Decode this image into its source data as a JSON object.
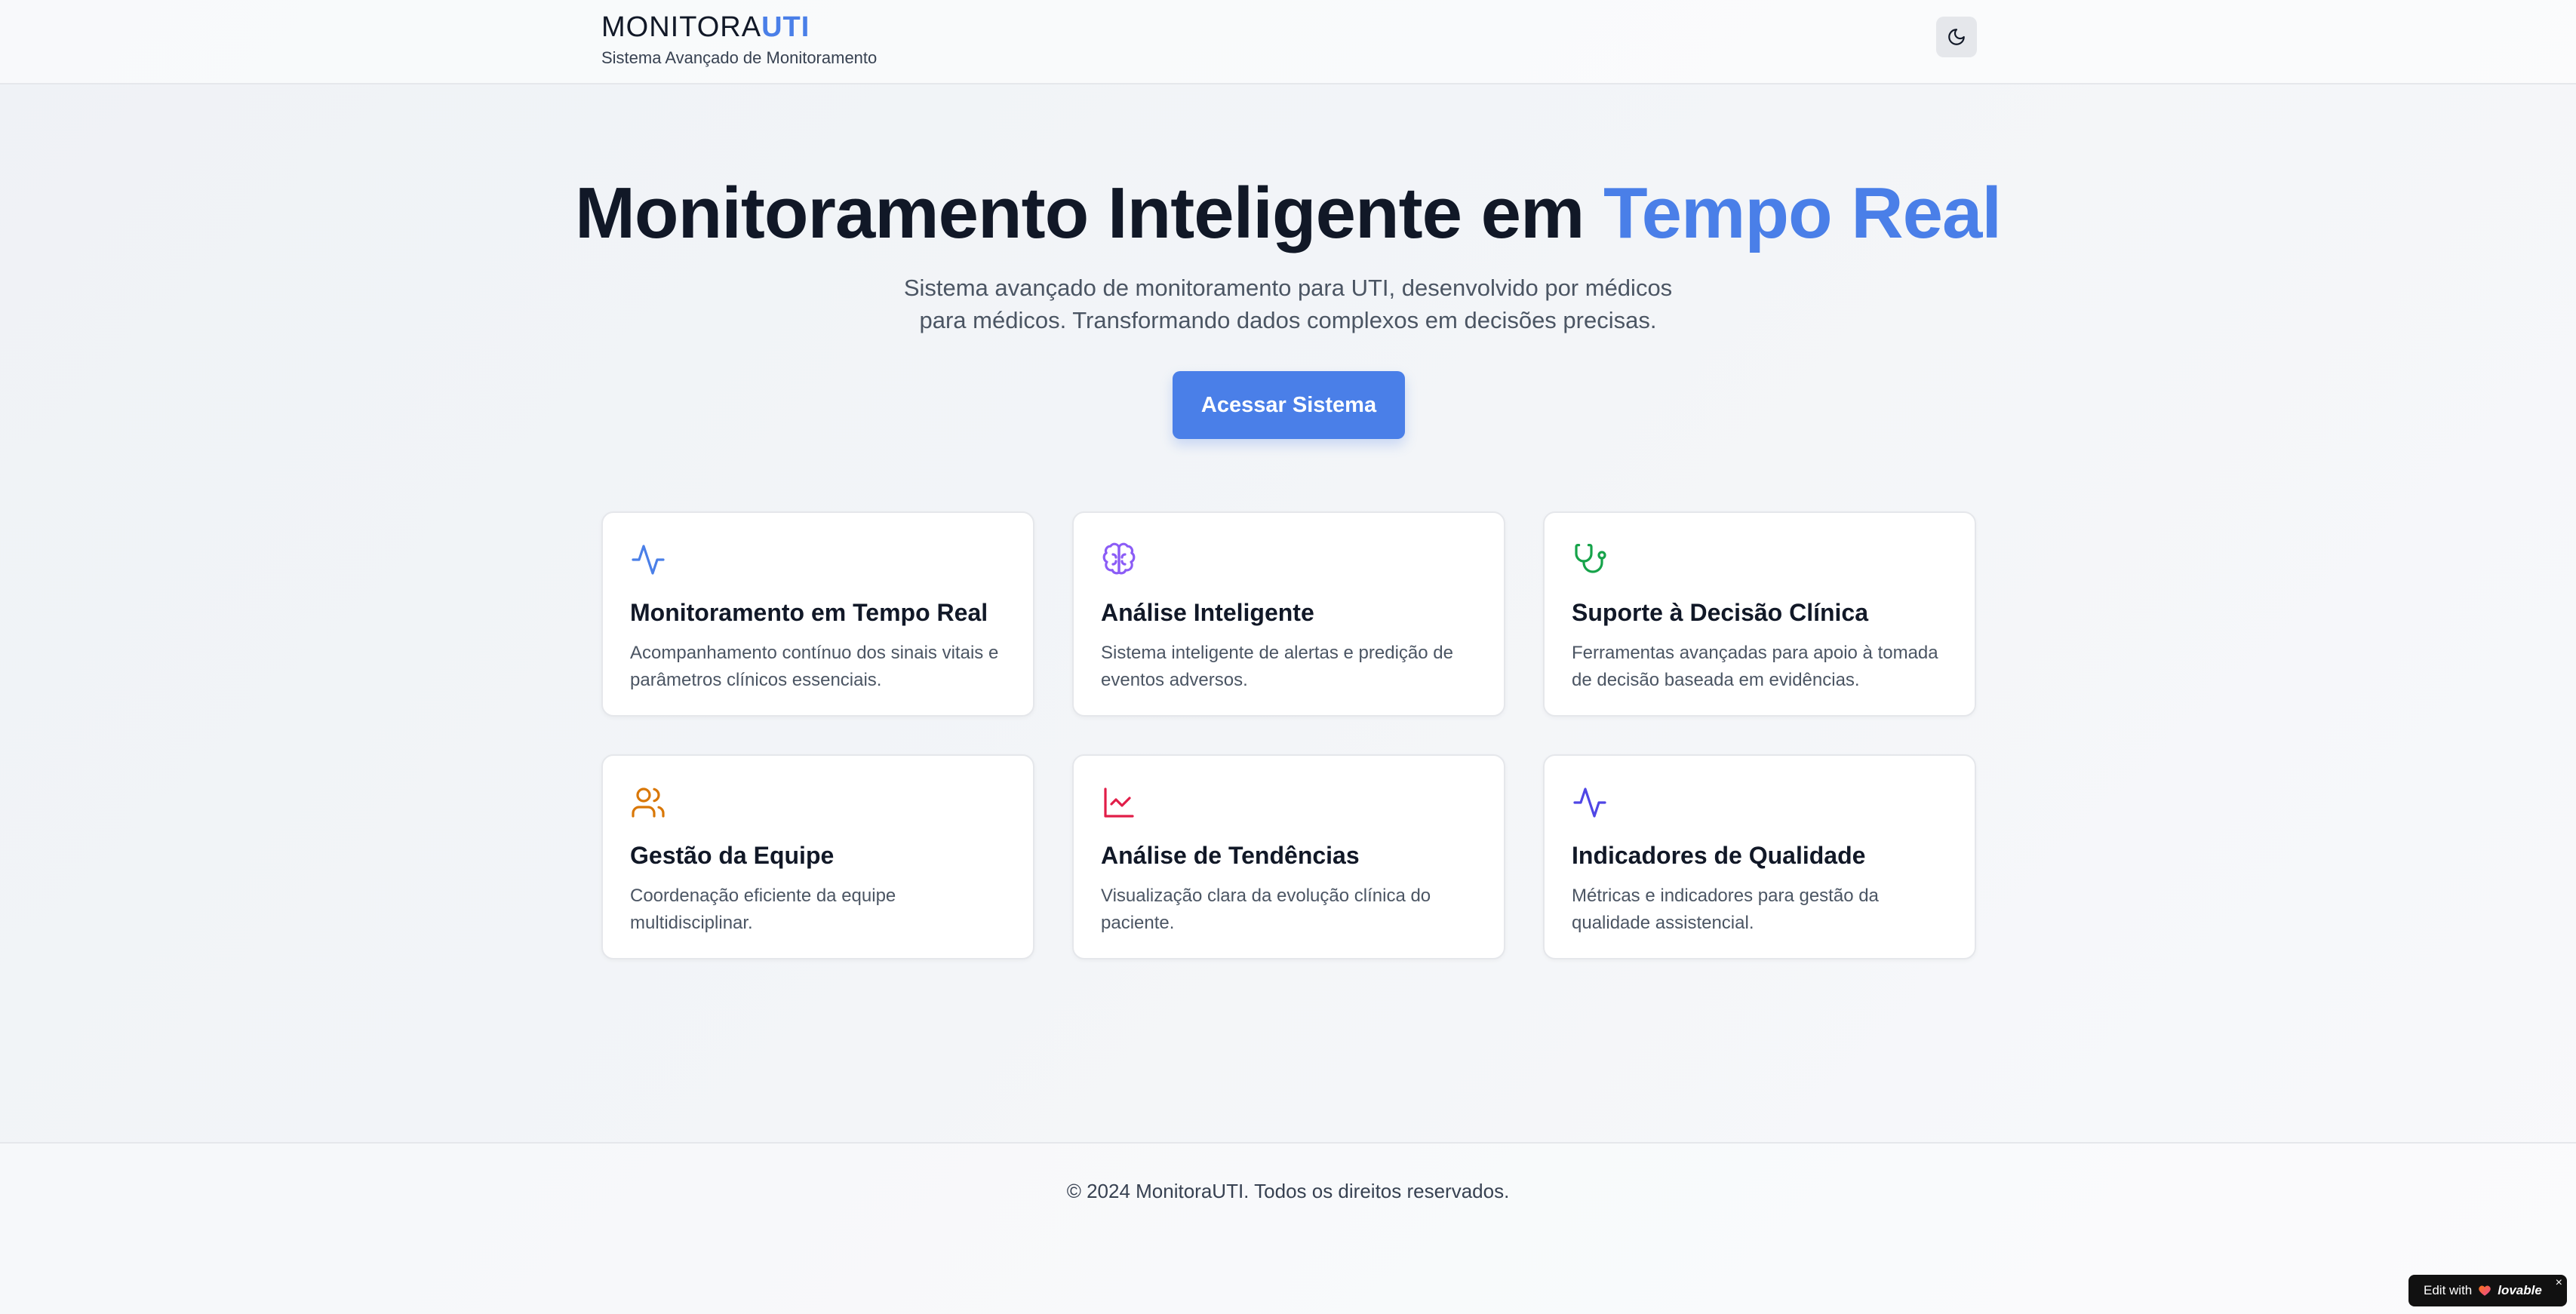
{
  "header": {
    "brand_prefix": "MONITORA",
    "brand_accent": "UTI",
    "subtitle": "Sistema Avançado de Monitoramento",
    "theme_toggle_icon": "moon-icon"
  },
  "hero": {
    "title_main": "Monitoramento Inteligente em ",
    "title_accent": "Tempo Real",
    "description_line1": "Sistema avançado de monitoramento para UTI, desenvolvido por médicos",
    "description_line2": "para médicos. Transformando dados complexos em decisões precisas.",
    "cta_label": "Acessar Sistema"
  },
  "features": [
    {
      "title": "Monitoramento em Tempo Real",
      "description": "Acompanhamento contínuo dos sinais vitais e parâmetros clínicos essenciais.",
      "icon": "activity-icon",
      "color": "#4a7fe8"
    },
    {
      "title": "Análise Inteligente",
      "description": "Sistema inteligente de alertas e predição de eventos adversos.",
      "icon": "brain-icon",
      "color": "#8b5cf6"
    },
    {
      "title": "Suporte à Decisão Clínica",
      "description": "Ferramentas avançadas para apoio à tomada de decisão baseada em evidências.",
      "icon": "stethoscope-icon",
      "color": "#16a34a"
    },
    {
      "title": "Gestão da Equipe",
      "description": "Coordenação eficiente da equipe multidisciplinar.",
      "icon": "users-icon",
      "color": "#d97706"
    },
    {
      "title": "Análise de Tendências",
      "description": "Visualização clara da evolução clínica do paciente.",
      "icon": "line-chart-icon",
      "color": "#e11d48"
    },
    {
      "title": "Indicadores de Qualidade",
      "description": "Métricas e indicadores para gestão da qualidade assistencial.",
      "icon": "activity-icon",
      "color": "#4f46e5"
    }
  ],
  "footer": {
    "text": "© 2024 MonitoraUTI. Todos os direitos reservados."
  },
  "badge": {
    "prefix": "Edit with",
    "brand": "lovable",
    "close": "×"
  }
}
